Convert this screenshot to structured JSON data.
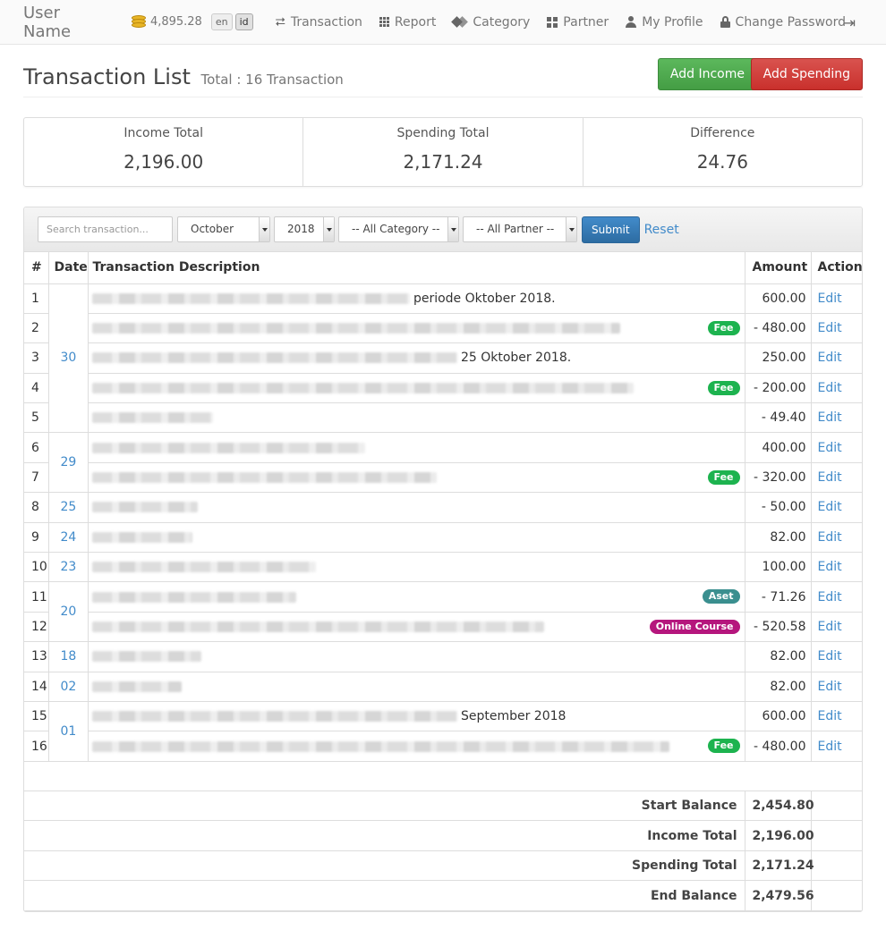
{
  "nav": {
    "user_name": "User Name",
    "balance": "4,895.28",
    "lang_en": "en",
    "lang_id": "id",
    "items": [
      {
        "label": "Transaction",
        "icon": "retweet-icon"
      },
      {
        "label": "Report",
        "icon": "report-icon"
      },
      {
        "label": "Category",
        "icon": "tags-icon"
      },
      {
        "label": "Partner",
        "icon": "partner-grid-icon"
      },
      {
        "label": "My Profile",
        "icon": "user-icon"
      },
      {
        "label": "Change Password",
        "icon": "lock-icon"
      }
    ],
    "logout_icon": "logout-icon"
  },
  "header": {
    "title": "Transaction List",
    "subtitle": "Total : 16 Transaction",
    "add_income": "Add Income",
    "add_spending": "Add Spending"
  },
  "summary": {
    "income_label": "Income Total",
    "income_value": "2,196.00",
    "spending_label": "Spending Total",
    "spending_value": "2,171.24",
    "difference_label": "Difference",
    "difference_value": "24.76"
  },
  "filters": {
    "search_placeholder": "Search transaction...",
    "month": "October",
    "year": "2018",
    "category": "-- All Category --",
    "partner": "-- All Partner --",
    "submit": "Submit",
    "reset": "Reset"
  },
  "table": {
    "headers": {
      "num": "#",
      "date": "Date",
      "desc": "Transaction Description",
      "amount": "Amount",
      "action": "Action"
    },
    "edit_label": "Edit",
    "rows": [
      {
        "num": "1",
        "date": "30",
        "desc_text": "periode Oktober 2018.",
        "amount": "600.00",
        "badge": ""
      },
      {
        "num": "2",
        "desc_text": "",
        "amount": "- 480.00",
        "badge": "Fee"
      },
      {
        "num": "3",
        "desc_text": "25 Oktober 2018.",
        "amount": "250.00",
        "badge": ""
      },
      {
        "num": "4",
        "desc_text": "",
        "amount": "- 200.00",
        "badge": "Fee"
      },
      {
        "num": "5",
        "desc_text": "",
        "amount": "- 49.40",
        "badge": ""
      },
      {
        "num": "6",
        "date": "29",
        "desc_text": "",
        "amount": "400.00",
        "badge": ""
      },
      {
        "num": "7",
        "desc_text": "",
        "amount": "- 320.00",
        "badge": "Fee"
      },
      {
        "num": "8",
        "date": "25",
        "desc_text": "",
        "amount": "- 50.00",
        "badge": ""
      },
      {
        "num": "9",
        "date": "24",
        "desc_text": "",
        "amount": "82.00",
        "badge": ""
      },
      {
        "num": "10",
        "date": "23",
        "desc_text": "",
        "amount": "100.00",
        "badge": ""
      },
      {
        "num": "11",
        "date": "20",
        "desc_text": "",
        "amount": "- 71.26",
        "badge": "Aset"
      },
      {
        "num": "12",
        "desc_text": "",
        "amount": "- 520.58",
        "badge": "Online Course"
      },
      {
        "num": "13",
        "date": "18",
        "desc_text": "",
        "amount": "82.00",
        "badge": ""
      },
      {
        "num": "14",
        "date": "02",
        "desc_text": "",
        "amount": "82.00",
        "badge": ""
      },
      {
        "num": "15",
        "date": "01",
        "desc_text": "September 2018",
        "amount": "600.00",
        "badge": ""
      },
      {
        "num": "16",
        "desc_text": "",
        "amount": "- 480.00",
        "badge": "Fee"
      }
    ]
  },
  "totals": {
    "start_label": "Start Balance",
    "start_value": "2,454.80",
    "income_label": "Income Total",
    "income_value": "2,196.00",
    "spending_label": "Spending Total",
    "spending_value": "2,171.24",
    "end_label": "End Balance",
    "end_value": "2,479.56"
  },
  "colors": {
    "link": "#428bca",
    "income_button": "#5cb85c",
    "spending_button": "#d9534f",
    "fee_badge": "#1db34f",
    "aset_badge": "#3a8f8f",
    "course_badge": "#b5167d"
  }
}
